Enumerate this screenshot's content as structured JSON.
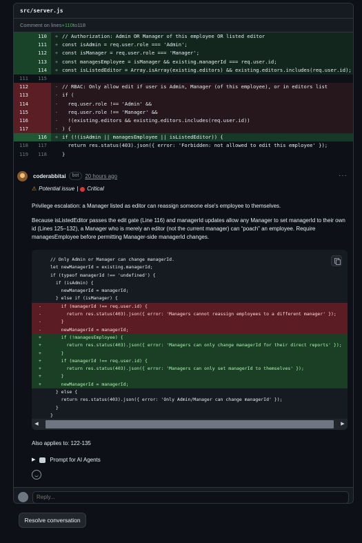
{
  "file": {
    "path": "src/server.js"
  },
  "comment_range": {
    "prefix": "Comment on lines ",
    "start": "+110",
    "to": " to ",
    "end": "118"
  },
  "diff": {
    "rows": [
      {
        "type": "add",
        "old": "",
        "new": "110",
        "mark": "+",
        "code": "// Authorization: Admin OR Manager of this employee OR listed editor"
      },
      {
        "type": "add",
        "old": "",
        "new": "111",
        "mark": "+",
        "code": "const isAdmin = req.user.role === 'Admin';"
      },
      {
        "type": "add",
        "old": "",
        "new": "112",
        "mark": "+",
        "code": "const isManager = req.user.role === 'Manager';"
      },
      {
        "type": "add",
        "old": "",
        "new": "113",
        "mark": "+",
        "code": "const managesEmployee = isManager && existing.managerId === req.user.id;"
      },
      {
        "type": "add",
        "old": "",
        "new": "114",
        "mark": "+",
        "code": "const isListedEditor = Array.isArray(existing.editors) && existing.editors.includes(req.user.id);"
      },
      {
        "type": "ctx",
        "old": "111",
        "new": "115",
        "mark": "",
        "code": ""
      },
      {
        "type": "del",
        "old": "112",
        "new": "",
        "mark": "-",
        "code": "// RBAC: Only allow edit if user is Admin, Manager (of this employee), or in editors list"
      },
      {
        "type": "del",
        "old": "113",
        "new": "",
        "mark": "-",
        "code": "if ("
      },
      {
        "type": "del",
        "old": "114",
        "new": "",
        "mark": "-",
        "code": "  req.user.role !== 'Admin' &&"
      },
      {
        "type": "del",
        "old": "115",
        "new": "",
        "mark": "-",
        "code": "  req.user.role !== 'Manager' &&"
      },
      {
        "type": "del",
        "old": "116",
        "new": "",
        "mark": "-",
        "code": "  !(existing.editors && existing.editors.includes(req.user.id))"
      },
      {
        "type": "del",
        "old": "117",
        "new": "",
        "mark": "-",
        "code": ") {"
      },
      {
        "type": "sel",
        "old": "",
        "new": "116",
        "mark": "+",
        "code": "if (!(isAdmin || managesEmployee || isListedEditor)) {"
      },
      {
        "type": "ctx",
        "old": "118",
        "new": "117",
        "mark": "",
        "code": "  return res.status(403).json({ error: 'Forbidden: not allowed to edit this employee' });"
      },
      {
        "type": "ctx",
        "old": "119",
        "new": "118",
        "mark": "",
        "code": "}"
      }
    ]
  },
  "comment": {
    "author": "coderabbitai",
    "badge": "bot",
    "time": "20 hours ago",
    "issue_label": "Potential issue",
    "separator": "|",
    "severity": "Critical",
    "title": "Privilege escalation: a Manager listed as editor can reassign someone else's employee to themselves.",
    "body": "Because isListedEditor passes the edit gate (Line 116) and managerId updates allow any Manager to set managerId to their own id (Lines 125–132), a Manager who is merely an editor (not the current manager) can “poach” an employee. Require managesEmployee before permitting Manager-side managerId changes.",
    "snippet": [
      {
        "t": " ",
        "code": "// Only Admin or Manager can change managerId."
      },
      {
        "t": " ",
        "code": "let newManagerId = existing.managerId;"
      },
      {
        "t": " ",
        "code": "if (typeof managerId !== 'undefined') {"
      },
      {
        "t": " ",
        "code": "  if (isAdmin) {"
      },
      {
        "t": " ",
        "code": "    newManagerId = managerId;"
      },
      {
        "t": " ",
        "code": "  } else if (isManager) {"
      },
      {
        "t": "-",
        "code": "    if (managerId !== req.user.id) {"
      },
      {
        "t": "-",
        "code": "      return res.status(403).json({ error: 'Managers cannot reassign employees to a different manager' });"
      },
      {
        "t": "-",
        "code": "    }"
      },
      {
        "t": "-",
        "code": "    newManagerId = managerId;"
      },
      {
        "t": "+",
        "code": "    if (!managesEmployee) {"
      },
      {
        "t": "+",
        "code": "      return res.status(403).json({ error: 'Managers can only change managerId for their direct reports' });"
      },
      {
        "t": "+",
        "code": "    }"
      },
      {
        "t": "+",
        "code": "    if (managerId !== req.user.id) {"
      },
      {
        "t": "+",
        "code": "      return res.status(403).json({ error: 'Managers can only set managerId to themselves' });"
      },
      {
        "t": "+",
        "code": "    }"
      },
      {
        "t": "+",
        "code": "    newManagerId = managerId;"
      },
      {
        "t": " ",
        "code": "  } else {"
      },
      {
        "t": " ",
        "code": "    return res.status(403).json({ error: 'Only Admin/Manager can change managerId' });"
      },
      {
        "t": " ",
        "code": "  }"
      },
      {
        "t": " ",
        "code": "}"
      }
    ],
    "applies": "Also applies to: 122-135",
    "prompt_label": "Prompt for AI Agents"
  },
  "reply": {
    "placeholder": "Reply..."
  },
  "resolve_label": "Resolve conversation",
  "colors": {
    "add": "#12261e",
    "del": "#25171c",
    "accent_green": "#3fb950",
    "critical": "#da3633"
  }
}
